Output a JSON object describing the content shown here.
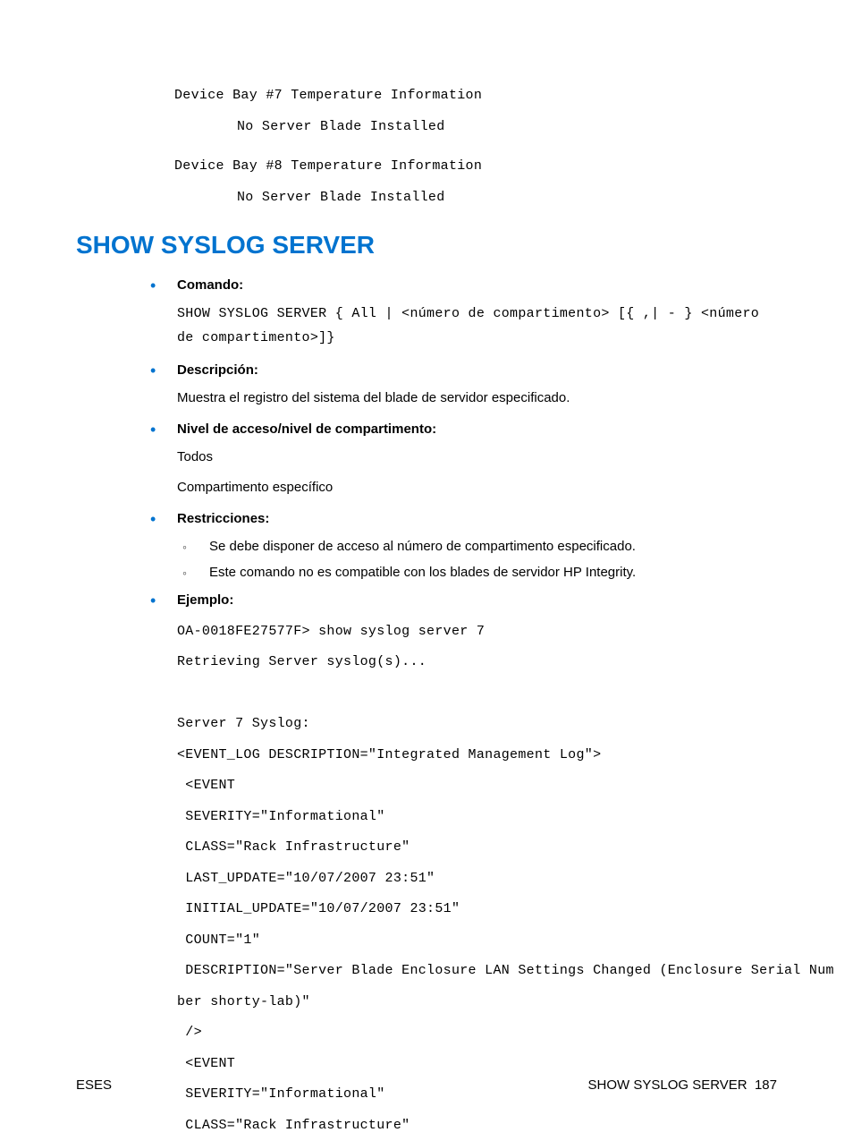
{
  "top_code": {
    "line1": "Device Bay #7 Temperature Information",
    "line2": "No Server Blade Installed",
    "line3": "Device Bay #8 Temperature Information",
    "line4": "No Server Blade Installed"
  },
  "heading": "SHOW SYSLOG SERVER",
  "items": {
    "comando": {
      "label": "Comando:",
      "syntax": "SHOW SYSLOG SERVER { All | <número de compartimento> [{ ,| - } <número de compartimento>]}"
    },
    "descripcion": {
      "label": "Descripción:",
      "text": "Muestra el registro del sistema del blade de servidor especificado."
    },
    "nivel": {
      "label": "Nivel de acceso/nivel de compartimento:",
      "text1": "Todos",
      "text2": "Compartimento específico"
    },
    "restricciones": {
      "label": "Restricciones:",
      "sub1": "Se debe disponer de acceso al número de compartimento especificado.",
      "sub2": "Este comando no es compatible con los blades de servidor HP Integrity."
    },
    "ejemplo": {
      "label": "Ejemplo:",
      "code": "OA-0018FE27577F> show syslog server 7\nRetrieving Server syslog(s)...\n\nServer 7 Syslog:\n<EVENT_LOG DESCRIPTION=\"Integrated Management Log\">\n <EVENT\n SEVERITY=\"Informational\"\n CLASS=\"Rack Infrastructure\"\n LAST_UPDATE=\"10/07/2007 23:51\"\n INITIAL_UPDATE=\"10/07/2007 23:51\"\n COUNT=\"1\"\n DESCRIPTION=\"Server Blade Enclosure LAN Settings Changed (Enclosure Serial Num\nber shorty-lab)\"\n />\n <EVENT\n SEVERITY=\"Informational\"\n CLASS=\"Rack Infrastructure\""
    }
  },
  "footer": {
    "left": "ESES",
    "right_label": "SHOW SYSLOG SERVER",
    "page": "187"
  }
}
